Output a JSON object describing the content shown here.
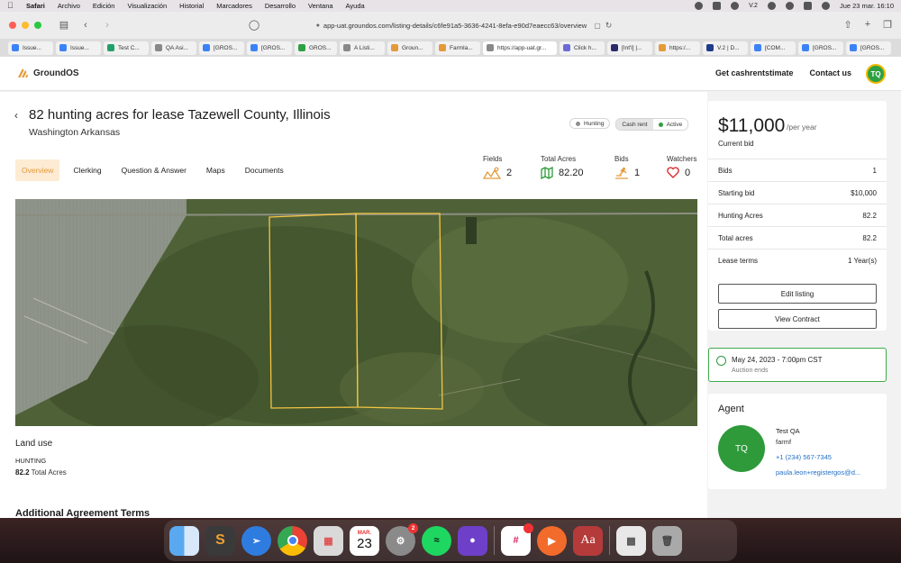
{
  "menubar": {
    "app": "Safari",
    "items": [
      "Archivo",
      "Edición",
      "Visualización",
      "Historial",
      "Marcadores",
      "Desarrollo",
      "Ventana",
      "Ayuda"
    ],
    "clock": "Jue 23 mar.  16:10",
    "status_label": "V.2"
  },
  "browser": {
    "url": "app-uat.groundos.com/listing-details/c6fe91a5-3636-4241-8efa-e90d7eaecc63/overview",
    "tabs": [
      "Issue...",
      "Issue...",
      "Test C...",
      "QA Asi...",
      "[GROS...",
      "[GROS...",
      "GROS...",
      "A Listi...",
      "Groun...",
      "Farmla...",
      "https://app-uat.gr...",
      "Click h...",
      "[Int'l] |...",
      "https:/...",
      "V.2 | D...",
      "[COM...",
      "[GROS...",
      "[GROS..."
    ],
    "tab_colors": [
      "#3b82f6",
      "#3b82f6",
      "#22a06b",
      "#888888",
      "#3b82f6",
      "#3b82f6",
      "#2ea043",
      "#888888",
      "#e39a3a",
      "#e39a3a",
      "#888888",
      "#6b6bd6",
      "#2b2b6b",
      "#e39a3a",
      "#1f3b8a",
      "#3b82f6",
      "#3b82f6",
      "#3b82f6"
    ]
  },
  "header": {
    "brand": "GroundOS",
    "nav": [
      "Get cashrentstimate",
      "Contact us"
    ],
    "avatar": "TQ"
  },
  "listing": {
    "title": "82 hunting acres for lease Tazewell County, Illinois",
    "subtitle": "Washington Arkansas",
    "chips": [
      {
        "label": "Hunting",
        "dot": "#8e8e8e"
      },
      {
        "label": "Cash rent",
        "dot": ""
      },
      {
        "label": "Active",
        "dot": "#2ea043"
      }
    ],
    "subnav": [
      "Overview",
      "Clerking",
      "Question & Answer",
      "Maps",
      "Documents"
    ],
    "stats": [
      {
        "label": "Fields",
        "value": "2",
        "icon": "fields-icon"
      },
      {
        "label": "Total Acres",
        "value": "82.20",
        "icon": "map-icon"
      },
      {
        "label": "Bids",
        "value": "1",
        "icon": "bids-icon"
      },
      {
        "label": "Watchers",
        "value": "0",
        "icon": "heart-icon"
      }
    ]
  },
  "land_use": {
    "heading": "Land use",
    "type": "HUNTING",
    "acres": "82.2",
    "acres_suffix": " Total Acres",
    "next_section": "Additional Agreement Terms"
  },
  "bid_card": {
    "price": "$11,000",
    "per": "/per year",
    "current": "Current bid",
    "rows": [
      {
        "label": "Bids",
        "value": "1"
      },
      {
        "label": "Starting bid",
        "value": "$10,000"
      },
      {
        "label": "Hunting Acres",
        "value": "82.2"
      },
      {
        "label": "Total acres",
        "value": "82.2"
      },
      {
        "label": "Lease terms",
        "value": "1 Year(s)"
      }
    ],
    "edit_button": "Edit listing",
    "contract_button": "View Contract"
  },
  "auction": {
    "date": "May 24, 2023 - 7:00pm CST",
    "label": "Auction ends"
  },
  "agent": {
    "heading": "Agent",
    "initials": "TQ",
    "name": "Test QA",
    "company": "farmf",
    "phone": "+1 (234) 567-7345",
    "email": "paula.leon+registergos@d..."
  },
  "dock": {
    "calendar_month": "MAR.",
    "calendar_day": "23",
    "settings_badge": "2",
    "slack_badge": "•",
    "dictionary_label": "Aa",
    "apps": [
      "finder-icon",
      "sublime-icon",
      "safari-icon",
      "chrome-icon",
      "launchpad-icon",
      "calendar-icon",
      "settings-icon",
      "spotify-icon",
      "github-icon",
      "slack-icon",
      "screenrecorder-icon",
      "dictionary-icon",
      "preview-icon",
      "trash-icon"
    ]
  },
  "colors": {
    "accent": "#e39a3a",
    "green": "#2ea043",
    "plot_outline": "#f5c542"
  }
}
